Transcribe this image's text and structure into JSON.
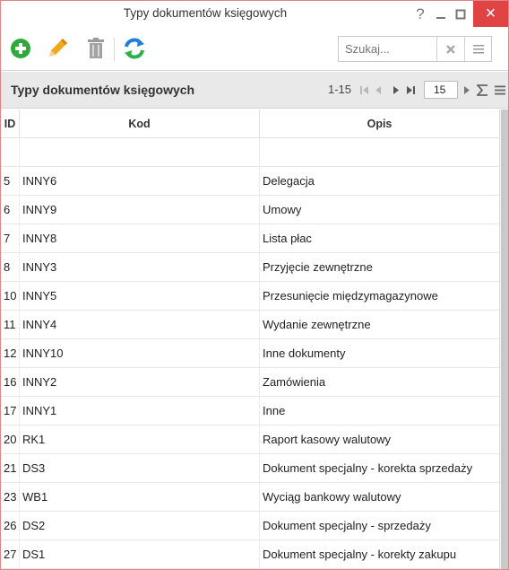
{
  "window": {
    "title": "Typy dokumentów księgowych",
    "help_label": "?",
    "close_label": "×"
  },
  "search": {
    "placeholder": "Szukaj..."
  },
  "grid": {
    "title": "Typy dokumentów księgowych",
    "range": "1-15",
    "page_size": "15",
    "columns": {
      "id": "ID",
      "kod": "Kod",
      "opis": "Opis"
    },
    "rows": [
      {
        "id": "",
        "kod": "",
        "opis": ""
      },
      {
        "id": "5",
        "kod": "INNY6",
        "opis": "Delegacja"
      },
      {
        "id": "6",
        "kod": "INNY9",
        "opis": "Umowy"
      },
      {
        "id": "7",
        "kod": "INNY8",
        "opis": "Lista płac"
      },
      {
        "id": "8",
        "kod": "INNY3",
        "opis": "Przyjęcie zewnętrzne"
      },
      {
        "id": "10",
        "kod": "INNY5",
        "opis": "Przesunięcie międzymagazynowe"
      },
      {
        "id": "11",
        "kod": "INNY4",
        "opis": "Wydanie zewnętrzne"
      },
      {
        "id": "12",
        "kod": "INNY10",
        "opis": "Inne dokumenty"
      },
      {
        "id": "16",
        "kod": "INNY2",
        "opis": "Zamówienia"
      },
      {
        "id": "17",
        "kod": "INNY1",
        "opis": "Inne"
      },
      {
        "id": "20",
        "kod": "RK1",
        "opis": "Raport kasowy walutowy"
      },
      {
        "id": "21",
        "kod": "DS3",
        "opis": "Dokument specjalny - korekta sprzedaży"
      },
      {
        "id": "23",
        "kod": "WB1",
        "opis": "Wyciąg bankowy walutowy"
      },
      {
        "id": "26",
        "kod": "DS2",
        "opis": "Dokument specjalny - sprzedaży"
      },
      {
        "id": "27",
        "kod": "DS1",
        "opis": "Dokument specjalny - korekty zakupu"
      }
    ]
  },
  "colors": {
    "add": "#2eaa3c",
    "edit": "#f0a81c",
    "delete": "#9a9a9a",
    "refresh_blue": "#1e7fd6",
    "refresh_green": "#2bb04a",
    "close_bg": "#e04343"
  },
  "icons": {
    "add": "plus-circle-icon",
    "edit": "pencil-icon",
    "delete": "trash-icon",
    "refresh": "refresh-icon",
    "clear": "x-icon",
    "menu": "hamburger-icon",
    "sum": "sigma-icon"
  }
}
